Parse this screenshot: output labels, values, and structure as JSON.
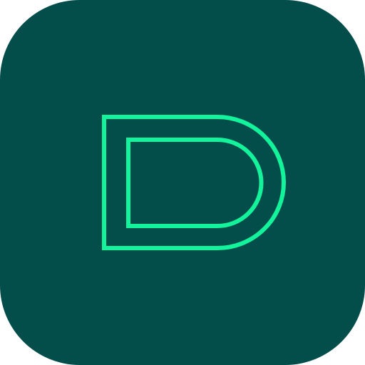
{
  "app_icon": {
    "name": "D logo app icon",
    "background_color": "#034e4b",
    "accent_color": "#12f39b",
    "icon": "letter-d-outline-icon"
  }
}
